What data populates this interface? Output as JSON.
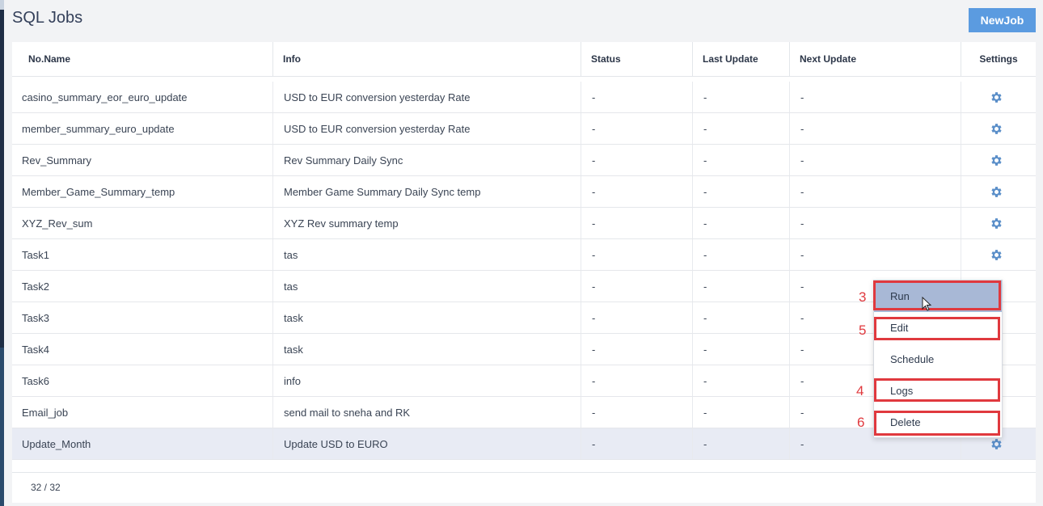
{
  "page": {
    "title": "SQL Jobs",
    "new_job_label": "NewJob"
  },
  "table": {
    "headers": {
      "name": "No.Name",
      "info": "Info",
      "status": "Status",
      "last_update": "Last Update",
      "next_update": "Next Update",
      "settings": "Settings"
    },
    "rows": [
      {
        "name": "casino_summary_eor_euro_update",
        "info": "USD to EUR conversion yesterday Rate",
        "status": "-",
        "last_update": "-",
        "next_update": "-"
      },
      {
        "name": "member_summary_euro_update",
        "info": "USD to EUR conversion yesterday Rate",
        "status": "-",
        "last_update": "-",
        "next_update": "-"
      },
      {
        "name": "Rev_Summary",
        "info": "Rev Summary Daily Sync",
        "status": "-",
        "last_update": "-",
        "next_update": "-"
      },
      {
        "name": "Member_Game_Summary_temp",
        "info": "Member Game Summary Daily Sync temp",
        "status": "-",
        "last_update": "-",
        "next_update": "-"
      },
      {
        "name": "XYZ_Rev_sum",
        "info": "XYZ Rev summary temp",
        "status": "-",
        "last_update": "-",
        "next_update": "-"
      },
      {
        "name": "Task1",
        "info": "tas",
        "status": "-",
        "last_update": "-",
        "next_update": "-"
      },
      {
        "name": "Task2",
        "info": "tas",
        "status": "-",
        "last_update": "-",
        "next_update": "-"
      },
      {
        "name": "Task3",
        "info": "task",
        "status": "-",
        "last_update": "-",
        "next_update": "-"
      },
      {
        "name": "Task4",
        "info": "task",
        "status": "-",
        "last_update": "-",
        "next_update": "-"
      },
      {
        "name": "Task6",
        "info": "info",
        "status": "-",
        "last_update": "-",
        "next_update": "-"
      },
      {
        "name": "Email_job",
        "info": "send mail to sneha and RK",
        "status": "-",
        "last_update": "-",
        "next_update": "-"
      },
      {
        "name": "Update_Month",
        "info": "Update USD to EURO",
        "status": "-",
        "last_update": "-",
        "next_update": "-"
      }
    ],
    "footer_count": "32 / 32"
  },
  "context_menu": {
    "items": [
      {
        "label": "Run",
        "annotation": "3"
      },
      {
        "label": "Edit",
        "annotation": "5"
      },
      {
        "label": "Schedule",
        "annotation": ""
      },
      {
        "label": "Logs",
        "annotation": "4"
      },
      {
        "label": "Delete",
        "annotation": "6"
      }
    ]
  },
  "icons": {
    "settings": "gear-icon",
    "cursor": "mouse-pointer-icon"
  },
  "colors": {
    "accent": "#5b9be0",
    "gear": "#5b8fc9",
    "menu_active": "#a8b8d6",
    "annotation_red": "#e0393e",
    "selected_row": "#e8ebf4"
  }
}
